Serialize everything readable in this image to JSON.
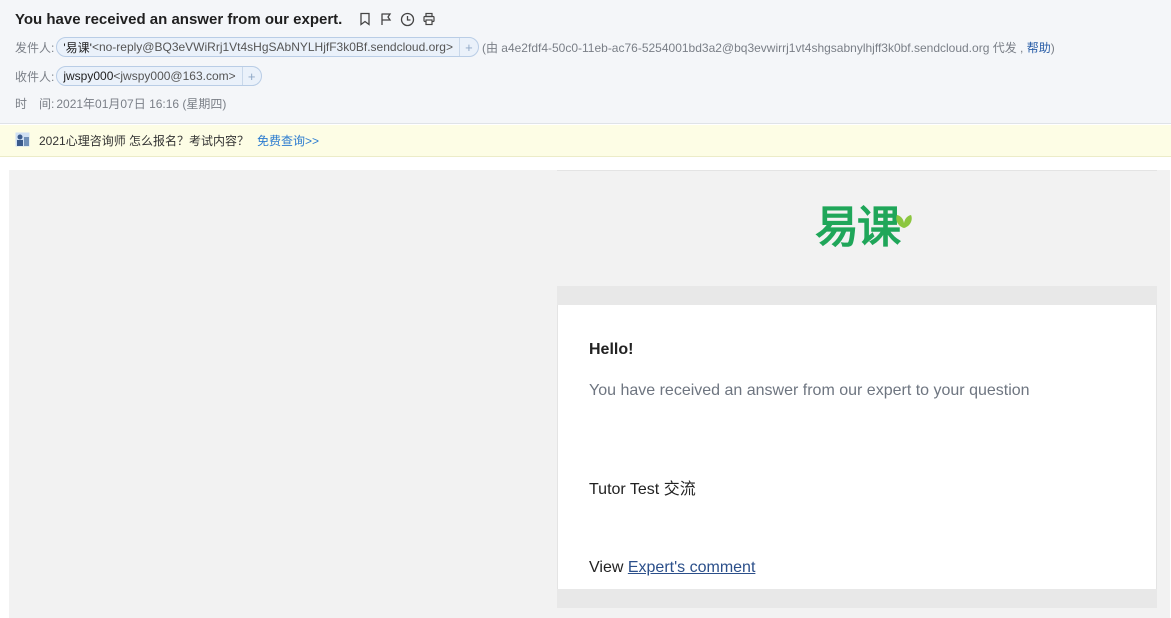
{
  "mail": {
    "subject": "You have received an answer from our expert.",
    "from_label": "发件人:",
    "from_name": "'易课'",
    "from_address": "<no-reply@BQ3eVWiRrj1Vt4sHgSAbNYLHjfF3k0Bf.sendcloud.org>",
    "via_text": "(由 a4e2fdf4-50c0-11eb-ac76-5254001bd3a2@bq3evwirrj1vt4shgsabnylhjff3k0bf.sendcloud.org 代发 ,",
    "help_link": "帮助",
    "via_close": ")",
    "to_label": "收件人:",
    "to_name": "jwspy000",
    "to_address": "<jwspy000@163.com>",
    "time_label": "时　间:",
    "time_value": "2021年01月07日 16:16 (星期四)",
    "plus_symbol": "+"
  },
  "ad": {
    "text": "2021心理咨询师 怎么报名？考试内容？",
    "link": "免费查询>>"
  },
  "body": {
    "logo_text": "易课",
    "hello": "Hello!",
    "message": "You have received an answer from our expert to your question",
    "tutor": "Tutor Test 交流",
    "view_prefix": "View ",
    "view_link": "Expert's comment"
  },
  "icons": {
    "toolbar": [
      "bookmark-icon",
      "flag-icon",
      "clock-icon",
      "print-icon"
    ],
    "ad": "promo-icon",
    "logo": "leaf-icon"
  },
  "colors": {
    "brand_green": "#1fa659",
    "link_blue": "#2b7bd0",
    "header_bg": "#f4f6f9",
    "ad_bg": "#fdfde5"
  }
}
